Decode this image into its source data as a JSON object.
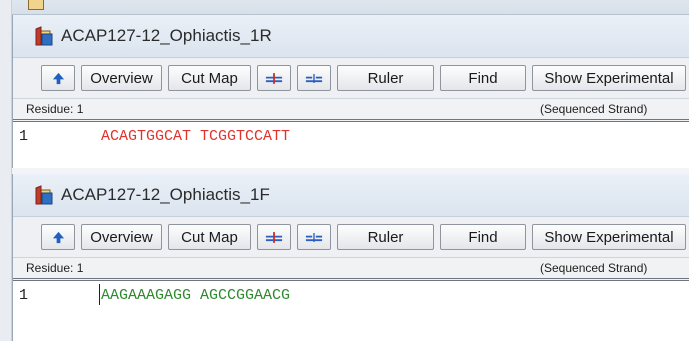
{
  "windows": [
    {
      "title": "ACAP127-12_Ophiactis_1R",
      "toolbar": {
        "overview": "Overview",
        "cut_map": "Cut Map",
        "ruler": "Ruler",
        "find": "Find",
        "show_experimental": "Show Experimental"
      },
      "residue_label": "Residue: 1",
      "strand_label": "(Sequenced Strand)",
      "line_number": "1",
      "sequence": "ACAGTGGCAT TCGGTCCATT",
      "sequence_color": "#e1322d"
    },
    {
      "title": "ACAP127-12_Ophiactis_1F",
      "toolbar": {
        "overview": "Overview",
        "cut_map": "Cut Map",
        "ruler": "Ruler",
        "find": "Find",
        "show_experimental": "Show Experimental"
      },
      "residue_label": "Residue: 1",
      "strand_label": "(Sequenced Strand)",
      "line_number": "1",
      "sequence": "AAGAAAGAGG AGCCGGAACG",
      "sequence_color": "#2e8a2e"
    }
  ],
  "icons": [
    "document-icon",
    "up-arrow-icon",
    "enzyme-marker-icon",
    "split-marker-icon"
  ]
}
